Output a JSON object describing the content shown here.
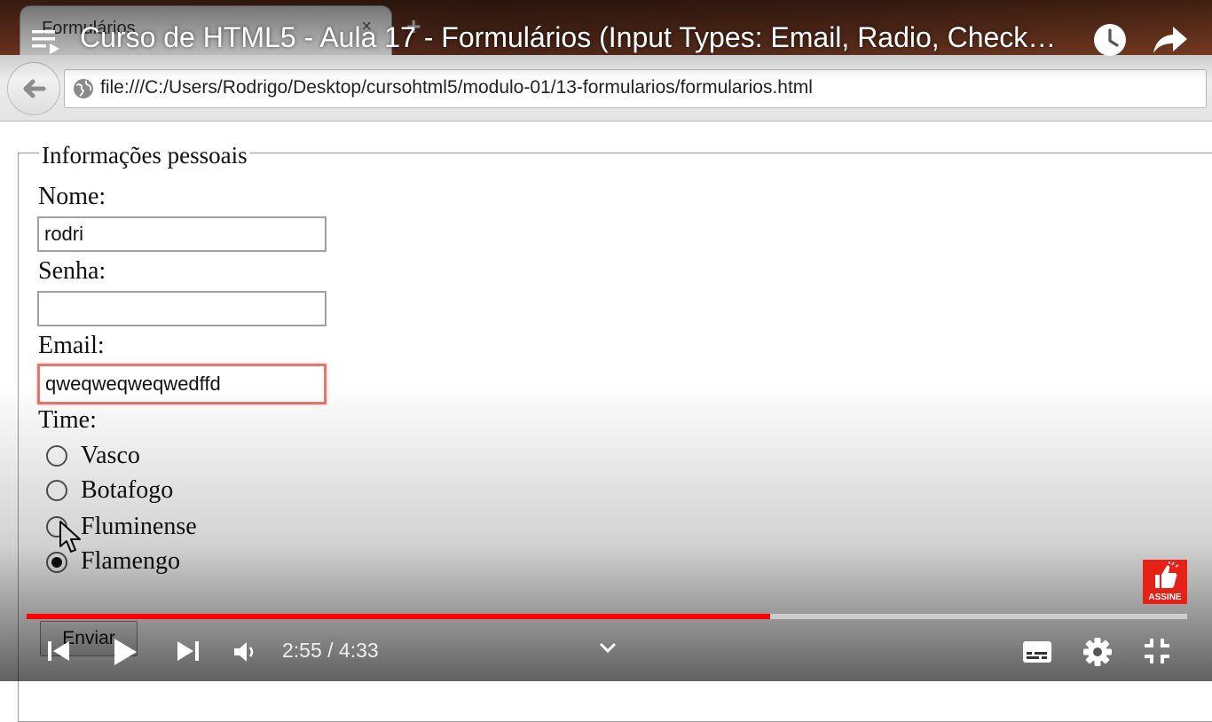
{
  "browser": {
    "tab_title": "Formulários",
    "tab_close": "×",
    "new_tab": "+",
    "url": "file:///C:/Users/Rodrigo/Desktop/cursohtml5/modulo-01/13-formularios/formularios.html"
  },
  "form": {
    "legend": "Informações pessoais",
    "nome": {
      "label": "Nome:",
      "value": "rodri"
    },
    "senha": {
      "label": "Senha:",
      "value": ""
    },
    "email": {
      "label": "Email:",
      "value": "qweqweqweqwedffd"
    },
    "time": {
      "label": "Time:",
      "options": [
        {
          "label": "Vasco",
          "checked": false
        },
        {
          "label": "Botafogo",
          "checked": false
        },
        {
          "label": "Fluminense",
          "checked": false
        },
        {
          "label": "Flamengo",
          "checked": true
        }
      ]
    },
    "submit_label": "Enviar"
  },
  "player": {
    "title": "Curso de HTML5 - Aula 17 - Formulários (Input Types: Email, Radio, Check…",
    "current_time": "2:55",
    "duration": "4:33",
    "time_display": "2:55 / 4:33",
    "progress": 0.641,
    "subscribe_label": "ASSINE",
    "accent_color": "#ff0000",
    "icons": [
      "playlist-icon",
      "watch-later-icon",
      "share-icon",
      "previous-icon",
      "play-icon",
      "next-icon",
      "volume-icon",
      "chevron-down-icon",
      "subtitles-icon",
      "settings-icon",
      "exit-fullscreen-icon"
    ]
  }
}
